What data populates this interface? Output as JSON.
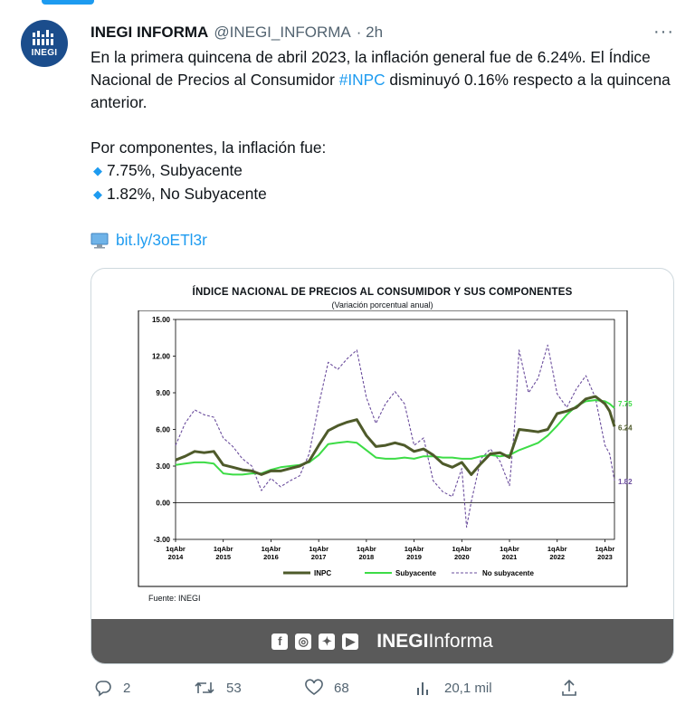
{
  "tweet": {
    "author_name": "INEGI INFORMA",
    "handle": "@INEGI_INFORMA",
    "time": "· 2h",
    "avatar_text": "INEGI",
    "more": "···",
    "text_line1": "En la primera quincena de abril 2023, la inflación general fue de 6.24%. El Índice Nacional de Precios al Consumidor ",
    "hashtag": "#INPC",
    "text_line1_end": " disminuyó 0.16% respecto a la quincena anterior.",
    "components_intro": "Por componentes, la inflación fue:",
    "bullet1": "7.75%, Subyacente",
    "bullet2": "1.82%, No Subyacente",
    "link": "bit.ly/3oETl3r"
  },
  "card": {
    "fuente": "Fuente: INEGI",
    "brand_bold": "INEGI",
    "brand_light": "Informa",
    "social_icons": [
      "facebook-icon",
      "instagram-icon",
      "twitter-icon",
      "youtube-icon"
    ]
  },
  "actions": {
    "replies": "2",
    "retweets": "53",
    "likes": "68",
    "views": "20,1 mil"
  },
  "colors": {
    "accent": "#1d9bf0",
    "inpc": "#4e5a2a",
    "subyacente": "#3ddc46",
    "no_subyacente": "#6a4c9c",
    "brand_bar": "#5a5a5a"
  },
  "chart_data": {
    "type": "line",
    "title": "Índice Nacional de Precios al Consumidor y sus componentes",
    "subtitle": "(Variación porcentual anual)",
    "ylim": [
      -3,
      15
    ],
    "yticks": [
      "15.00",
      "12.00",
      "9.00",
      "6.00",
      "3.00",
      "0.00",
      "-3.00"
    ],
    "yvals": [
      15,
      12,
      9,
      6,
      3,
      0,
      -3
    ],
    "xticks": [
      [
        "1qAbr",
        "2014"
      ],
      [
        "1qAbr",
        "2015"
      ],
      [
        "1qAbr",
        "2016"
      ],
      [
        "1qAbr",
        "2017"
      ],
      [
        "1qAbr",
        "2018"
      ],
      [
        "1qAbr",
        "2019"
      ],
      [
        "1qAbr",
        "2020"
      ],
      [
        "1qAbr",
        "2021"
      ],
      [
        "1qAbr",
        "2022"
      ],
      [
        "1qAbr",
        "2023"
      ]
    ],
    "xvals": [
      2014,
      2015,
      2016,
      2017,
      2018,
      2019,
      2020,
      2021,
      2022,
      2023
    ],
    "xlim": [
      2014,
      2023.2
    ],
    "end_labels": [
      "7.75",
      "6.24",
      "1.82"
    ],
    "grid": false,
    "legend_position": "bottom",
    "series": [
      {
        "name": "INPC",
        "x": [
          2014.0,
          2014.2,
          2014.4,
          2014.6,
          2014.8,
          2015.0,
          2015.2,
          2015.4,
          2015.6,
          2015.8,
          2016.0,
          2016.2,
          2016.4,
          2016.6,
          2016.8,
          2017.0,
          2017.2,
          2017.4,
          2017.6,
          2017.8,
          2018.0,
          2018.2,
          2018.4,
          2018.6,
          2018.8,
          2019.0,
          2019.2,
          2019.4,
          2019.6,
          2019.8,
          2020.0,
          2020.2,
          2020.4,
          2020.6,
          2020.8,
          2021.0,
          2021.2,
          2021.4,
          2021.6,
          2021.8,
          2022.0,
          2022.2,
          2022.4,
          2022.6,
          2022.8,
          2023.0,
          2023.1,
          2023.2
        ],
        "values": [
          3.5,
          3.8,
          4.2,
          4.1,
          4.2,
          3.1,
          2.9,
          2.7,
          2.6,
          2.3,
          2.6,
          2.6,
          2.8,
          3.0,
          3.4,
          4.7,
          5.9,
          6.3,
          6.6,
          6.8,
          5.5,
          4.6,
          4.7,
          4.9,
          4.7,
          4.2,
          4.4,
          3.9,
          3.2,
          2.9,
          3.3,
          2.3,
          3.2,
          4.0,
          4.1,
          3.7,
          6.0,
          5.9,
          5.8,
          6.0,
          7.3,
          7.5,
          7.8,
          8.5,
          8.7,
          8.1,
          7.5,
          6.24
        ]
      },
      {
        "name": "Subyacente",
        "x": [
          2014.0,
          2014.2,
          2014.4,
          2014.6,
          2014.8,
          2015.0,
          2015.2,
          2015.4,
          2015.6,
          2015.8,
          2016.0,
          2016.2,
          2016.4,
          2016.6,
          2016.8,
          2017.0,
          2017.2,
          2017.4,
          2017.6,
          2017.8,
          2018.0,
          2018.2,
          2018.4,
          2018.6,
          2018.8,
          2019.0,
          2019.2,
          2019.4,
          2019.6,
          2019.8,
          2020.0,
          2020.2,
          2020.4,
          2020.6,
          2020.8,
          2021.0,
          2021.2,
          2021.4,
          2021.6,
          2021.8,
          2022.0,
          2022.2,
          2022.4,
          2022.6,
          2022.8,
          2023.0,
          2023.1,
          2023.2
        ],
        "values": [
          3.1,
          3.2,
          3.3,
          3.3,
          3.2,
          2.4,
          2.3,
          2.3,
          2.4,
          2.4,
          2.7,
          2.9,
          3.0,
          3.1,
          3.3,
          3.9,
          4.8,
          4.9,
          5.0,
          4.9,
          4.3,
          3.7,
          3.6,
          3.6,
          3.7,
          3.6,
          3.8,
          3.8,
          3.7,
          3.7,
          3.6,
          3.6,
          3.8,
          3.9,
          3.8,
          3.9,
          4.3,
          4.6,
          4.9,
          5.5,
          6.3,
          7.2,
          7.9,
          8.3,
          8.4,
          8.3,
          8.1,
          7.75
        ]
      },
      {
        "name": "No subyacente",
        "x": [
          2014.0,
          2014.2,
          2014.4,
          2014.6,
          2014.8,
          2015.0,
          2015.2,
          2015.4,
          2015.6,
          2015.8,
          2016.0,
          2016.2,
          2016.4,
          2016.6,
          2016.8,
          2017.0,
          2017.2,
          2017.4,
          2017.6,
          2017.8,
          2018.0,
          2018.2,
          2018.4,
          2018.6,
          2018.8,
          2019.0,
          2019.2,
          2019.4,
          2019.6,
          2019.8,
          2020.0,
          2020.1,
          2020.2,
          2020.4,
          2020.6,
          2020.8,
          2021.0,
          2021.1,
          2021.2,
          2021.4,
          2021.6,
          2021.8,
          2022.0,
          2022.2,
          2022.4,
          2022.6,
          2022.8,
          2023.0,
          2023.1,
          2023.2
        ],
        "values": [
          4.7,
          6.5,
          7.6,
          7.2,
          7.0,
          5.3,
          4.6,
          3.6,
          3.0,
          1.0,
          2.0,
          1.3,
          1.8,
          2.2,
          4.0,
          8.0,
          11.5,
          10.9,
          11.8,
          12.5,
          8.6,
          6.5,
          8.1,
          9.1,
          8.1,
          4.7,
          5.3,
          1.8,
          0.9,
          0.5,
          2.8,
          -2.0,
          0.1,
          3.6,
          4.4,
          3.4,
          1.4,
          6.0,
          12.5,
          9.0,
          10.2,
          12.9,
          8.9,
          7.8,
          9.3,
          10.4,
          8.6,
          4.7,
          4.0,
          1.82
        ]
      }
    ]
  }
}
